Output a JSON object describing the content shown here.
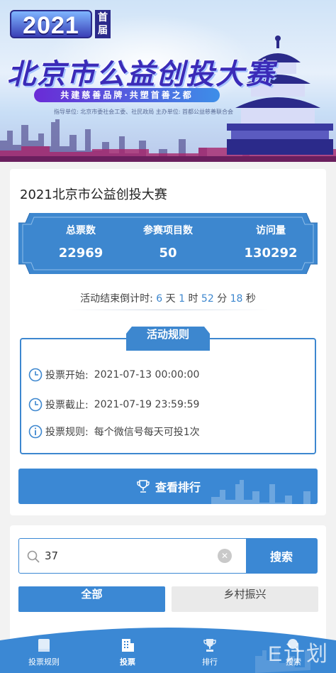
{
  "banner": {
    "badge_year": "2021",
    "badge_sub": "首届",
    "title": "北京市公益创投大赛",
    "slogan": "共建慈善品牌·共塑首善之都",
    "organizer": "指导单位: 北京市委社会工委、社民政局    主办单位: 首都公益慈善联合会"
  },
  "event": {
    "title": "2021北京市公益创投大赛"
  },
  "stats": [
    {
      "label": "总票数",
      "value": "22969"
    },
    {
      "label": "参赛项目数",
      "value": "50"
    },
    {
      "label": "访问量",
      "value": "130292"
    }
  ],
  "countdown": {
    "prefix": "活动结束倒计时:",
    "days": "6",
    "days_unit": "天",
    "hours": "1",
    "hours_unit": "时",
    "minutes": "52",
    "minutes_unit": "分",
    "seconds": "18",
    "seconds_unit": "秒"
  },
  "rules": {
    "tab_label": "活动规则",
    "start_label": "投票开始:",
    "start_value": "2021-07-13 00:00:00",
    "end_label": "投票截止:",
    "end_value": "2021-07-19 23:59:59",
    "rule_label": "投票规则:",
    "rule_value": "每个微信号每天可投1次"
  },
  "rank_button": {
    "label": "查看排行"
  },
  "search": {
    "value": "37",
    "button_label": "搜索"
  },
  "categories": [
    {
      "label": "全部",
      "active": true
    },
    {
      "label": "乡村振兴",
      "active": false
    }
  ],
  "tabbar": [
    {
      "label": "投票规则",
      "icon": "book-icon"
    },
    {
      "label": "投票",
      "icon": "building-icon",
      "active": true
    },
    {
      "label": "排行",
      "icon": "trophy-icon"
    },
    {
      "label": "搜索",
      "icon": "search-icon"
    }
  ],
  "watermark": "E计划",
  "colors": {
    "primary": "#3b88d4",
    "accent_text": "#3d87cf"
  }
}
